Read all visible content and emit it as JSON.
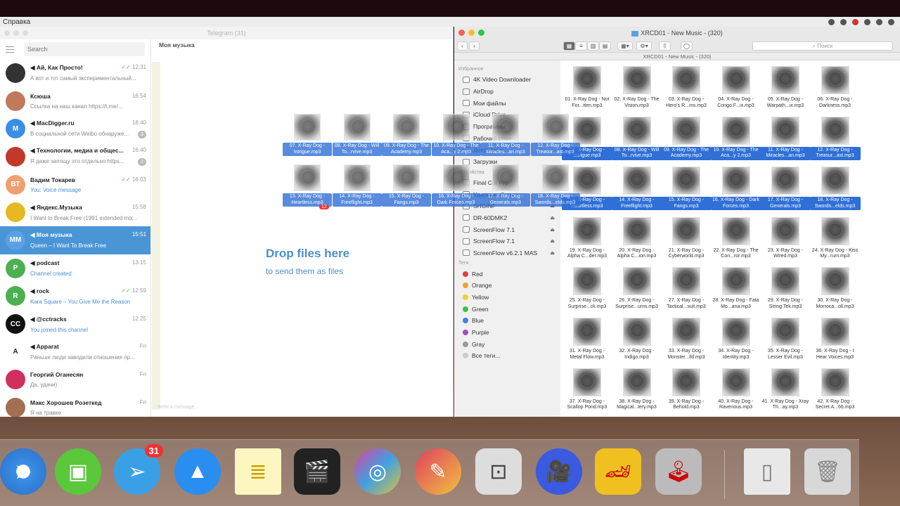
{
  "menubar": {
    "app_menu": "Справка"
  },
  "telegram": {
    "window_title": "Telegram (31)",
    "search_placeholder": "Search",
    "chat_title": "Моя музыка",
    "drop_title": "Drop files here",
    "drop_subtitle": "to send them as files",
    "composer_placeholder": "Write a message...",
    "chats": [
      {
        "initials": "",
        "name": "Ай, Как Просто!",
        "time": "12:31",
        "msg": "А вот и тот самый экспериментальный...",
        "color": "#333",
        "check": true
      },
      {
        "initials": "",
        "name": "Ксюша",
        "time": "16:54",
        "msg": "Ссылка на наш канал https://t.me/...",
        "color": "#c07a5a"
      },
      {
        "initials": "M",
        "name": "MacDigger.ru",
        "time": "18:40",
        "msg": "В социальной сети Weibo обнаруже...",
        "color": "#3a8ee6",
        "badge": "3"
      },
      {
        "initials": "",
        "name": "Технологии, медиа и общес...",
        "time": "16:40",
        "msg": "Я даже запощу это отдельно https...",
        "color": "#c0392b",
        "badge": "2"
      },
      {
        "initials": "ВТ",
        "name": "Вадим Токарев",
        "time": "16:03",
        "msg": "You: Voice message",
        "color": "#f0a070",
        "check": true,
        "blue": true
      },
      {
        "initials": "",
        "name": "Яндекс.Музыка",
        "time": "15:58",
        "msg": "I Want to Break Free (1991 extended mix...",
        "color": "#e8b820"
      },
      {
        "initials": "ММ",
        "name": "Моя музыка",
        "time": "15:51",
        "msg": "Queen – I Want To Break Free",
        "color": "#5aa0e6",
        "active": true
      },
      {
        "initials": "P",
        "name": "podcast",
        "time": "13:15",
        "msg": "Channel created",
        "color": "#4caf50",
        "blue": true
      },
      {
        "initials": "R",
        "name": "rock",
        "time": "12:59",
        "msg": "Kara Square – You Give Me the Reason",
        "color": "#4caf50",
        "check": true,
        "blue": true
      },
      {
        "initials": "CC",
        "name": "@cctracks",
        "time": "12:25",
        "msg": "You joined this channel",
        "color": "#111",
        "blue": true
      },
      {
        "initials": "A",
        "name": "Apparat",
        "time": "Fri",
        "msg": "Раньше люди заводили отношения пр...",
        "color": "#fff"
      },
      {
        "initials": "",
        "name": "Георгий Оганесян",
        "time": "Fri",
        "msg": "Да, удачи)",
        "color": "#d03060"
      },
      {
        "initials": "",
        "name": "Макс Хорошев Розеткед",
        "time": "Fri",
        "msg": "Я на травке",
        "color": "#a07050"
      }
    ]
  },
  "dragged_files": [
    "07. X-Ray Dog - Intrigue.mp3",
    "08. X-Ray Dog - Will To...rvive.mp3",
    "09. X-Ray Dog - The Academy.mp3",
    "10. X-Ray Dog - The Aca...y 2.mp3",
    "11. X-Ray Dog - Miracles...an.mp3",
    "12. X-Ray Dog - Treasur...ast.mp3",
    "13. X-Ray Dog - Heartless.mp3",
    "14. X-Ray Dog - Freeflight.mp3",
    "15. X-Ray Dog - Fangs.mp3",
    "16. X-Ray Dog - Dark Forces.mp3",
    "17. X-Ray Dog - Generals.mp3",
    "18. X-Ray Dog - Swords...elds.mp3"
  ],
  "drag_count_badge": "12",
  "finder": {
    "window_title": "XRCD01 - New Music - (320)",
    "path_title": "XRCD01 - New Music - (320)",
    "search_placeholder": "Поиск",
    "favorites_heading": "Избранное",
    "favorites": [
      "4K Video Downloader",
      "AirDrop",
      "Мои файлы",
      "iCloud Drive",
      "Программы",
      "Рабочий стол",
      "Документы",
      "Загрузки"
    ],
    "devices_heading": "Устройства",
    "devices": [
      "Final Cut Pro",
      "Удаленный диск",
      "SHGINF",
      "DR-60DMK2",
      "ScreenFlow 7.1",
      "ScreenFlow 7.1",
      "ScreenFlow v6.2.1 MAS"
    ],
    "tags_heading": "Теги",
    "tags": [
      {
        "name": "Red",
        "color": "#e04040"
      },
      {
        "name": "Orange",
        "color": "#f0a030"
      },
      {
        "name": "Yellow",
        "color": "#f0d030"
      },
      {
        "name": "Green",
        "color": "#40c040"
      },
      {
        "name": "Blue",
        "color": "#4080e0"
      },
      {
        "name": "Purple",
        "color": "#a050c0"
      },
      {
        "name": "Gray",
        "color": "#999999"
      },
      {
        "name": "Все теги...",
        "color": "#cccccc"
      }
    ],
    "files": [
      "01. X-Ray Dog - Not For...tten.mp3",
      "02. X-Ray Dog - The Vision.mp3",
      "03. X-Ray Dog - Hero's R...ms.mp3",
      "04. X-Ray Dog - Congo F...ix.mp3",
      "05. X-Ray Dog - Warpath...ix.mp3",
      "06. X-Ray Dog - Darkness.mp3",
      "07. X-Ray Dog - Intrigue.mp3",
      "08. X-Ray Dog - Will To...rvive.mp3",
      "09. X-Ray Dog - The Academy.mp3",
      "10. X-Ray Dog - The Aca...y 2.mp3",
      "11. X-Ray Dog - Miracles...an.mp3",
      "12. X-Ray Dog - Treasur...ast.mp3",
      "13. X-Ray Dog - Heartless.mp3",
      "14. X-Ray Dog - Freeflight.mp3",
      "15. X-Ray Dog - Fangs.mp3",
      "16. X-Ray Dog - Dark Forces.mp3",
      "17. X-Ray Dog - Generals.mp3",
      "18. X-Ray Dog - Swords...elds.mp3",
      "19. X-Ray Dog - Alpha C...der.mp3",
      "20. X-Ray Dog - Alpha C...ion.mp3",
      "21. X-Ray Dog - Cyberworld.mp3",
      "22. X-Ray Dog - The Con...ror.mp3",
      "23. X-Ray Dog - Wired.mp3",
      "24. X-Ray Dog - Kiss My...rum.mp3",
      "25. X-Ray Dog - Surprise...ck.mp3",
      "26. X-Ray Dog - Surprise...ums.mp3",
      "27. X-Ray Dog - Tactical...suit.mp3",
      "28. X-Ray Dog - Fata Mo...ana.mp3",
      "29. X-Ray Dog - String Tek.mp3",
      "30. X-Ray Dog - Morroca...oll.mp3",
      "31. X-Ray Dog - Metal Flow.mp3",
      "32. X-Ray Dog - Indigo.mp3",
      "33. X-Ray Dog - Monster...lld.mp3",
      "34. X-Ray Dog - Identity.mp3",
      "35. X-Ray Dog - Lesser Evil.mp3",
      "36. X-Ray Dog - I Hear Voices.mp3",
      "37. X-Ray Dog - Scallop Pond.mp3",
      "38. X-Ray Dog - Magical...tery.mp3",
      "39. X-Ray Dog - Behold.mp3",
      "40. X-Ray Dog - Ravenous.mp3",
      "41. X-Ray Dog - Xray Th...ay.mp3",
      "42. X-Ray Dog - Secret A...66.mp3"
    ],
    "selected_range": [
      7,
      18
    ]
  },
  "dock": {
    "telegram_badge": "31",
    "apps": [
      "safari-icon",
      "filmora-icon",
      "telegram-icon",
      "testflight-icon",
      "notes-icon",
      "final-cut-icon",
      "motion-icon",
      "goose-icon",
      "screenflow-icon",
      "imovie-icon",
      "racing-game-icon",
      "joystick-icon",
      "file-icon",
      "trash-icon"
    ]
  }
}
